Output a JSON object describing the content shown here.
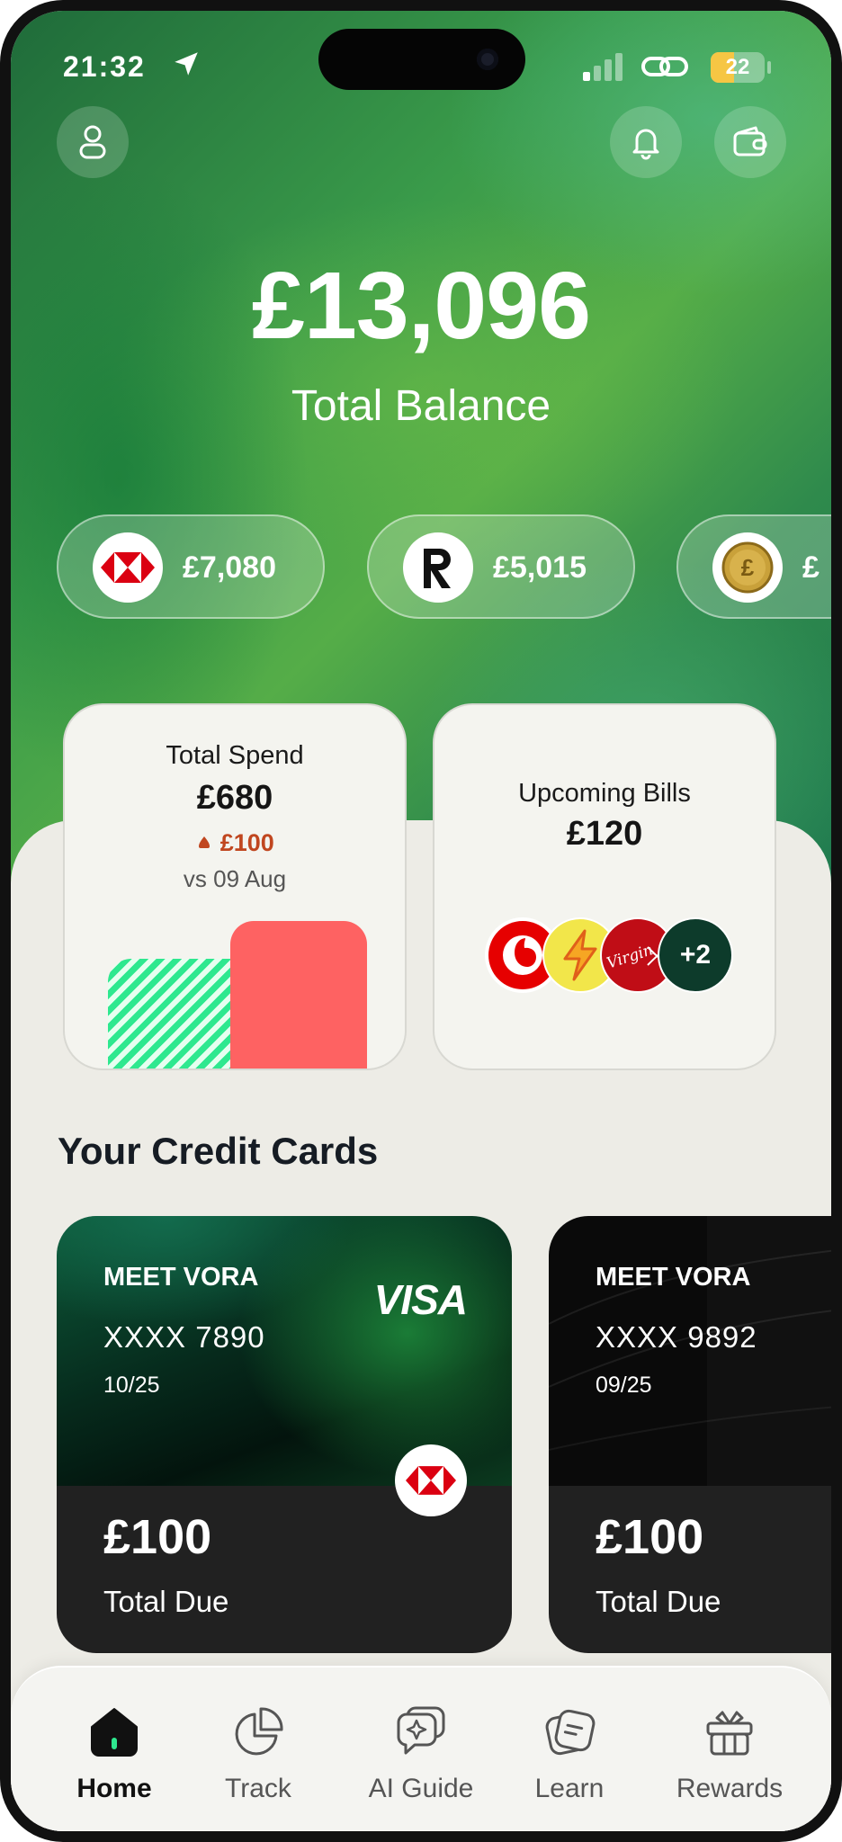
{
  "status_bar": {
    "time": "21:32",
    "battery": "22"
  },
  "balance": {
    "amount": "£13,096",
    "label": "Total Balance"
  },
  "accounts": [
    {
      "bank": "hsbc-logo",
      "amount": "£7,080"
    },
    {
      "bank": "revolut-logo",
      "amount": "£5,015"
    },
    {
      "bank": "coin-logo",
      "amount": "£"
    }
  ],
  "total_spend": {
    "title": "Total Spend",
    "amount": "£680",
    "delta": "£100",
    "comparison": "vs 09 Aug"
  },
  "upcoming_bills": {
    "title": "Upcoming Bills",
    "amount": "£120",
    "providers": [
      "vodafone-logo",
      "energy-logo",
      "virgin-media-logo"
    ],
    "more": "+2"
  },
  "credit_cards_section": {
    "title": "Your Credit Cards"
  },
  "credit_cards": [
    {
      "brand": "MEET VORA",
      "number": "XXXX 7890",
      "expiry": "10/25",
      "network": "VISA",
      "due": "£100",
      "due_label": "Total Due"
    },
    {
      "brand": "MEET VORA",
      "number": "XXXX 9892",
      "expiry": "09/25",
      "due": "£100",
      "due_label": "Total Due"
    }
  ],
  "tabs": [
    {
      "label": "Home",
      "icon": "home-icon",
      "active": true
    },
    {
      "label": "Track",
      "icon": "pie-chart-icon"
    },
    {
      "label": "AI Guide",
      "icon": "ai-chat-icon"
    },
    {
      "label": "Learn",
      "icon": "notes-icon"
    },
    {
      "label": "Rewards",
      "icon": "gift-icon"
    }
  ],
  "colors": {
    "accent_green": "#2ee88f",
    "spend_red": "#fe6262",
    "delta_up": "#c0461f",
    "hsbc_red": "#db0011",
    "sheet_bg": "#edece6"
  }
}
